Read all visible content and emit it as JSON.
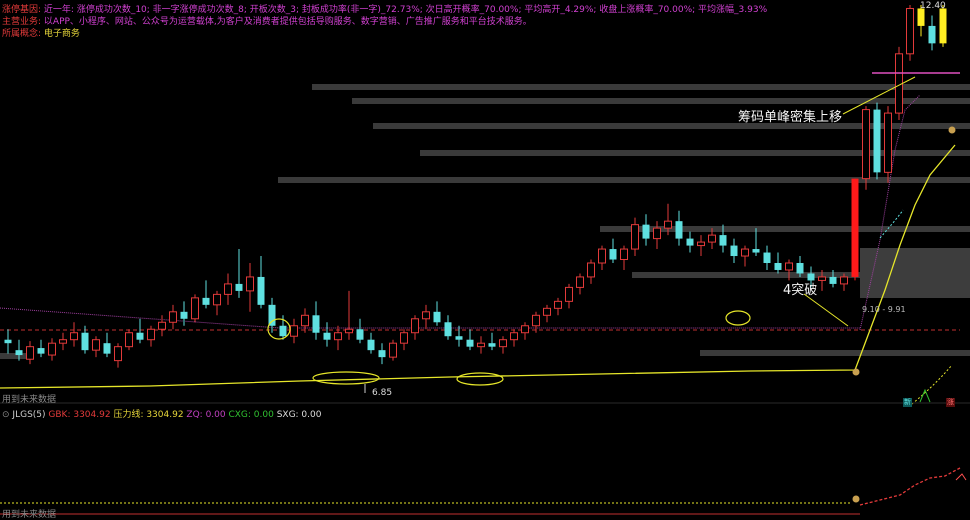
{
  "header": {
    "row1_label": "涨停基因:",
    "row1_text": "近一年: 涨停成功次数_10; 非一字涨停成功次数_8; 开板次数_3; 封板成功率(非一字)_72.73%; 次日高开概率_70.00%; 平均高开_4.29%; 收盘上涨概率_70.00%; 平均涨幅_3.93%",
    "row2_label": "主营业务:",
    "row2_text": "以APP、小程序、网站、公众号为运营载体,为客户及消费者提供包括导购服务、数字营销、广告推广服务和平台技术服务。",
    "row3_label": "所属概念:",
    "row3_text": "电子商务"
  },
  "price_labels": {
    "top_right": "12.40",
    "low_marker": "6.85",
    "mid_marker": "9.10 - 9.91"
  },
  "annotations": {
    "breakout": "4突破",
    "chip_shift": "筹码单峰密集上移"
  },
  "hints": {
    "main_bottom": "用到未来数据",
    "indicator_bottom": "用到未来数据"
  },
  "indicator": {
    "name": "JLGS(5)",
    "items": [
      {
        "label": "GBK: 3304.92",
        "color": "#e23a3a"
      },
      {
        "label": "压力线: 3304.92",
        "color": "#e6d63a"
      },
      {
        "label": "ZQ: 0.00",
        "color": "#c040c0"
      },
      {
        "label": "CXG: 0.00",
        "color": "#30c030"
      },
      {
        "label": "SXG: 0.00",
        "color": "#dddddd"
      }
    ]
  },
  "markers": {
    "left_box": "新",
    "right_box": "涨"
  },
  "colors": {
    "up": "#e23a3a",
    "down": "#5fe0e0",
    "support_line": "#e6e62a",
    "resistance": "#a040a0",
    "highlight_yellow": "#ffee22",
    "highlight_red": "#ff1a1a",
    "chip_gray": "#3a3a3a"
  },
  "chart_data": {
    "type": "candlestick",
    "candles": [
      {
        "o": 7.6,
        "h": 7.75,
        "l": 7.4,
        "c": 7.55
      },
      {
        "o": 7.45,
        "h": 7.6,
        "l": 7.3,
        "c": 7.38
      },
      {
        "o": 7.32,
        "h": 7.58,
        "l": 7.25,
        "c": 7.5
      },
      {
        "o": 7.48,
        "h": 7.6,
        "l": 7.35,
        "c": 7.4
      },
      {
        "o": 7.38,
        "h": 7.62,
        "l": 7.3,
        "c": 7.55
      },
      {
        "o": 7.55,
        "h": 7.7,
        "l": 7.45,
        "c": 7.6
      },
      {
        "o": 7.6,
        "h": 7.85,
        "l": 7.5,
        "c": 7.7
      },
      {
        "o": 7.7,
        "h": 7.8,
        "l": 7.4,
        "c": 7.45
      },
      {
        "o": 7.45,
        "h": 7.65,
        "l": 7.35,
        "c": 7.6
      },
      {
        "o": 7.55,
        "h": 7.7,
        "l": 7.35,
        "c": 7.4
      },
      {
        "o": 7.3,
        "h": 7.55,
        "l": 7.2,
        "c": 7.5
      },
      {
        "o": 7.5,
        "h": 7.75,
        "l": 7.45,
        "c": 7.7
      },
      {
        "o": 7.7,
        "h": 7.9,
        "l": 7.55,
        "c": 7.6
      },
      {
        "o": 7.6,
        "h": 7.8,
        "l": 7.5,
        "c": 7.75
      },
      {
        "o": 7.75,
        "h": 7.95,
        "l": 7.65,
        "c": 7.85
      },
      {
        "o": 7.85,
        "h": 8.1,
        "l": 7.75,
        "c": 8.0
      },
      {
        "o": 8.0,
        "h": 8.15,
        "l": 7.8,
        "c": 7.9
      },
      {
        "o": 7.9,
        "h": 8.25,
        "l": 7.85,
        "c": 8.2
      },
      {
        "o": 8.2,
        "h": 8.45,
        "l": 8.05,
        "c": 8.1
      },
      {
        "o": 8.1,
        "h": 8.3,
        "l": 7.95,
        "c": 8.25
      },
      {
        "o": 8.25,
        "h": 8.55,
        "l": 8.1,
        "c": 8.4
      },
      {
        "o": 8.4,
        "h": 8.9,
        "l": 8.2,
        "c": 8.3
      },
      {
        "o": 8.3,
        "h": 8.7,
        "l": 8.0,
        "c": 8.5
      },
      {
        "o": 8.5,
        "h": 8.8,
        "l": 8.05,
        "c": 8.1
      },
      {
        "o": 8.1,
        "h": 8.2,
        "l": 7.7,
        "c": 7.8
      },
      {
        "o": 7.8,
        "h": 7.95,
        "l": 7.6,
        "c": 7.65
      },
      {
        "o": 7.65,
        "h": 7.9,
        "l": 7.55,
        "c": 7.8
      },
      {
        "o": 7.8,
        "h": 8.05,
        "l": 7.7,
        "c": 7.95
      },
      {
        "o": 7.95,
        "h": 8.15,
        "l": 7.6,
        "c": 7.7
      },
      {
        "o": 7.7,
        "h": 7.85,
        "l": 7.5,
        "c": 7.6
      },
      {
        "o": 7.6,
        "h": 7.8,
        "l": 7.45,
        "c": 7.7
      },
      {
        "o": 7.7,
        "h": 8.3,
        "l": 7.6,
        "c": 7.75
      },
      {
        "o": 7.75,
        "h": 7.9,
        "l": 7.55,
        "c": 7.6
      },
      {
        "o": 7.6,
        "h": 7.7,
        "l": 7.4,
        "c": 7.45
      },
      {
        "o": 7.45,
        "h": 7.55,
        "l": 7.25,
        "c": 7.35
      },
      {
        "o": 7.35,
        "h": 7.6,
        "l": 7.3,
        "c": 7.55
      },
      {
        "o": 7.55,
        "h": 7.75,
        "l": 7.45,
        "c": 7.7
      },
      {
        "o": 7.7,
        "h": 7.95,
        "l": 7.6,
        "c": 7.9
      },
      {
        "o": 7.9,
        "h": 8.1,
        "l": 7.75,
        "c": 8.0
      },
      {
        "o": 8.0,
        "h": 8.15,
        "l": 7.8,
        "c": 7.85
      },
      {
        "o": 7.85,
        "h": 7.95,
        "l": 7.6,
        "c": 7.65
      },
      {
        "o": 7.65,
        "h": 7.8,
        "l": 7.5,
        "c": 7.6
      },
      {
        "o": 7.6,
        "h": 7.75,
        "l": 7.45,
        "c": 7.5
      },
      {
        "o": 7.5,
        "h": 7.65,
        "l": 7.4,
        "c": 7.55
      },
      {
        "o": 7.55,
        "h": 7.7,
        "l": 7.45,
        "c": 7.5
      },
      {
        "o": 7.5,
        "h": 7.65,
        "l": 7.4,
        "c": 7.6
      },
      {
        "o": 7.6,
        "h": 7.75,
        "l": 7.5,
        "c": 7.7
      },
      {
        "o": 7.7,
        "h": 7.85,
        "l": 7.6,
        "c": 7.8
      },
      {
        "o": 7.8,
        "h": 8.0,
        "l": 7.7,
        "c": 7.95
      },
      {
        "o": 7.95,
        "h": 8.1,
        "l": 7.85,
        "c": 8.05
      },
      {
        "o": 8.05,
        "h": 8.2,
        "l": 7.95,
        "c": 8.15
      },
      {
        "o": 8.15,
        "h": 8.4,
        "l": 8.05,
        "c": 8.35
      },
      {
        "o": 8.35,
        "h": 8.55,
        "l": 8.25,
        "c": 8.5
      },
      {
        "o": 8.5,
        "h": 8.75,
        "l": 8.4,
        "c": 8.7
      },
      {
        "o": 8.7,
        "h": 8.95,
        "l": 8.6,
        "c": 8.9
      },
      {
        "o": 8.9,
        "h": 9.05,
        "l": 8.7,
        "c": 8.75
      },
      {
        "o": 8.75,
        "h": 8.95,
        "l": 8.6,
        "c": 8.9
      },
      {
        "o": 8.9,
        "h": 9.35,
        "l": 8.8,
        "c": 9.25
      },
      {
        "o": 9.25,
        "h": 9.4,
        "l": 8.95,
        "c": 9.05
      },
      {
        "o": 9.05,
        "h": 9.3,
        "l": 8.9,
        "c": 9.2
      },
      {
        "o": 9.2,
        "h": 9.55,
        "l": 9.1,
        "c": 9.3
      },
      {
        "o": 9.3,
        "h": 9.45,
        "l": 8.95,
        "c": 9.05
      },
      {
        "o": 9.05,
        "h": 9.15,
        "l": 8.85,
        "c": 8.95
      },
      {
        "o": 8.95,
        "h": 9.1,
        "l": 8.8,
        "c": 9.0
      },
      {
        "o": 9.0,
        "h": 9.2,
        "l": 8.9,
        "c": 9.1
      },
      {
        "o": 9.1,
        "h": 9.25,
        "l": 8.85,
        "c": 8.95
      },
      {
        "o": 8.95,
        "h": 9.05,
        "l": 8.7,
        "c": 8.8
      },
      {
        "o": 8.8,
        "h": 8.95,
        "l": 8.65,
        "c": 8.9
      },
      {
        "o": 8.9,
        "h": 9.2,
        "l": 8.8,
        "c": 8.85
      },
      {
        "o": 8.85,
        "h": 8.95,
        "l": 8.6,
        "c": 8.7
      },
      {
        "o": 8.7,
        "h": 8.85,
        "l": 8.55,
        "c": 8.6
      },
      {
        "o": 8.6,
        "h": 8.75,
        "l": 8.45,
        "c": 8.7
      },
      {
        "o": 8.7,
        "h": 8.8,
        "l": 8.5,
        "c": 8.55
      },
      {
        "o": 8.55,
        "h": 8.65,
        "l": 8.35,
        "c": 8.45
      },
      {
        "o": 8.45,
        "h": 8.6,
        "l": 8.3,
        "c": 8.5
      },
      {
        "o": 8.5,
        "h": 8.6,
        "l": 8.35,
        "c": 8.4
      },
      {
        "o": 8.4,
        "h": 8.55,
        "l": 8.3,
        "c": 8.5
      },
      {
        "o": 8.5,
        "h": 9.91,
        "l": 8.45,
        "c": 9.91
      },
      {
        "o": 9.91,
        "h": 10.95,
        "l": 9.75,
        "c": 10.9
      },
      {
        "o": 10.9,
        "h": 11.0,
        "l": 9.9,
        "c": 10.0
      },
      {
        "o": 10.0,
        "h": 10.95,
        "l": 9.85,
        "c": 10.85
      },
      {
        "o": 10.85,
        "h": 11.8,
        "l": 10.75,
        "c": 11.7
      },
      {
        "o": 11.7,
        "h": 12.4,
        "l": 11.6,
        "c": 12.35
      },
      {
        "o": 12.35,
        "h": 12.4,
        "l": 11.95,
        "c": 12.1
      },
      {
        "o": 12.1,
        "h": 12.25,
        "l": 11.75,
        "c": 11.85
      },
      {
        "o": 11.85,
        "h": 12.4,
        "l": 11.8,
        "c": 12.35
      }
    ]
  }
}
